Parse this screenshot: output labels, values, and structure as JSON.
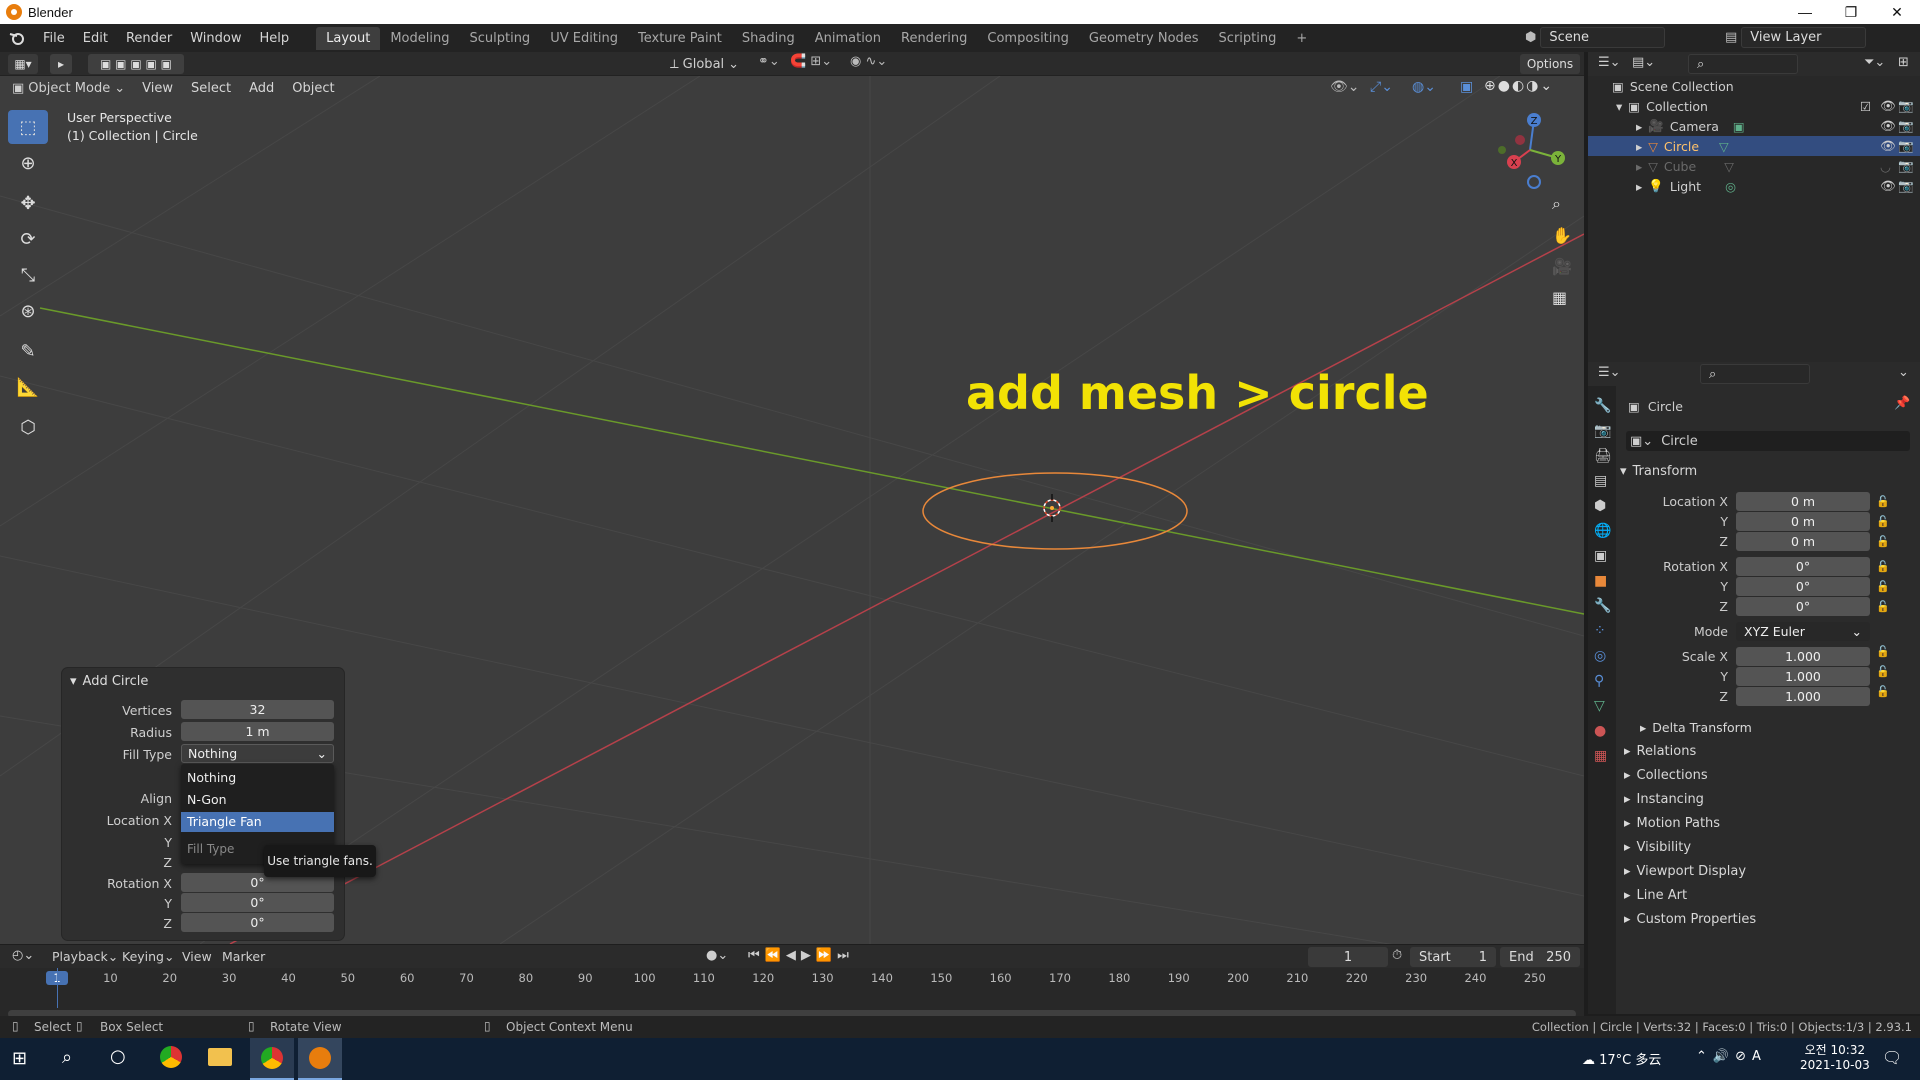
{
  "window": {
    "title": "Blender",
    "minimize": "—",
    "maximize": "❐",
    "close": "✕"
  },
  "menu": [
    "File",
    "Edit",
    "Render",
    "Window",
    "Help"
  ],
  "workspaces": [
    "Layout",
    "Modeling",
    "Sculpting",
    "UV Editing",
    "Texture Paint",
    "Shading",
    "Animation",
    "Rendering",
    "Compositing",
    "Geometry Nodes",
    "Scripting",
    "+"
  ],
  "scene": {
    "name": "Scene",
    "view_layer": "View Layer"
  },
  "header": {
    "transform_orientation": "Global",
    "options": "Options"
  },
  "viewport_header": {
    "mode": "Object Mode",
    "menus": [
      "View",
      "Select",
      "Add",
      "Object"
    ]
  },
  "viewport": {
    "perspective": "User Perspective",
    "collection_label": "(1) Collection | Circle",
    "overlay_text": "add mesh > circle",
    "axis_labels": {
      "x": "X",
      "y": "Y",
      "z": "Z"
    }
  },
  "operator_panel": {
    "title": "Add Circle",
    "vertices_label": "Vertices",
    "vertices": "32",
    "radius_label": "Radius",
    "radius": "1 m",
    "fill_type_label": "Fill Type",
    "fill_type": "Nothing",
    "align_label": "Align",
    "location_x_label": "Location X",
    "y_label": "Y",
    "z_label": "Z",
    "rotation_x_label": "Rotation X",
    "rotation_x": "0°",
    "rotation_y": "0°",
    "rotation_z": "0°",
    "dropdown_options": [
      "Nothing",
      "N-Gon",
      "Triangle Fan"
    ],
    "dropdown_header": "Fill Type",
    "tooltip": "Use triangle fans."
  },
  "outliner": {
    "root": "Scene Collection",
    "collection": "Collection",
    "items": [
      {
        "name": "Camera"
      },
      {
        "name": "Circle"
      },
      {
        "name": "Cube"
      },
      {
        "name": "Light"
      }
    ]
  },
  "properties": {
    "object_name": "Circle",
    "data_name": "Circle",
    "transform_header": "Transform",
    "location_x_label": "Location X",
    "location_x": "0 m",
    "location_y_label": "Y",
    "location_y": "0 m",
    "location_z_label": "Z",
    "location_z": "0 m",
    "rotation_x_label": "Rotation X",
    "rotation_x": "0°",
    "rotation_y_label": "Y",
    "rotation_y": "0°",
    "rotation_z_label": "Z",
    "rotation_z": "0°",
    "mode_label": "Mode",
    "mode": "XYZ Euler",
    "scale_x_label": "Scale X",
    "scale_x": "1.000",
    "scale_y_label": "Y",
    "scale_y": "1.000",
    "scale_z_label": "Z",
    "scale_z": "1.000",
    "delta_transform": "Delta Transform",
    "sections": [
      "Relations",
      "Collections",
      "Instancing",
      "Motion Paths",
      "Visibility",
      "Viewport Display",
      "Line Art",
      "Custom Properties"
    ]
  },
  "timeline": {
    "menus": [
      "Playback",
      "Keying",
      "View",
      "Marker"
    ],
    "current_frame": "1",
    "start_label": "Start",
    "start": "1",
    "end_label": "End",
    "end": "250",
    "ticks": [
      "1",
      "10",
      "20",
      "30",
      "40",
      "50",
      "60",
      "70",
      "80",
      "90",
      "100",
      "110",
      "120",
      "130",
      "140",
      "150",
      "160",
      "170",
      "180",
      "190",
      "200",
      "210",
      "220",
      "230",
      "240",
      "250"
    ]
  },
  "statusbar": {
    "select": "Select",
    "box_select": "Box Select",
    "rotate_view": "Rotate View",
    "context_menu": "Object Context Menu",
    "info": "Collection | Circle | Verts:32 | Faces:0 | Tris:0 | Objects:1/3 | 2.93.1"
  },
  "taskbar": {
    "weather": "17°C 多云",
    "time": "오전 10:32",
    "date": "2021-10-03"
  },
  "colors": {
    "accent": "#4772b3",
    "selection": "#e8883a",
    "overlay_text": "#f2e205",
    "x_axis": "#b5414a",
    "y_axis": "#6a9a2a"
  }
}
